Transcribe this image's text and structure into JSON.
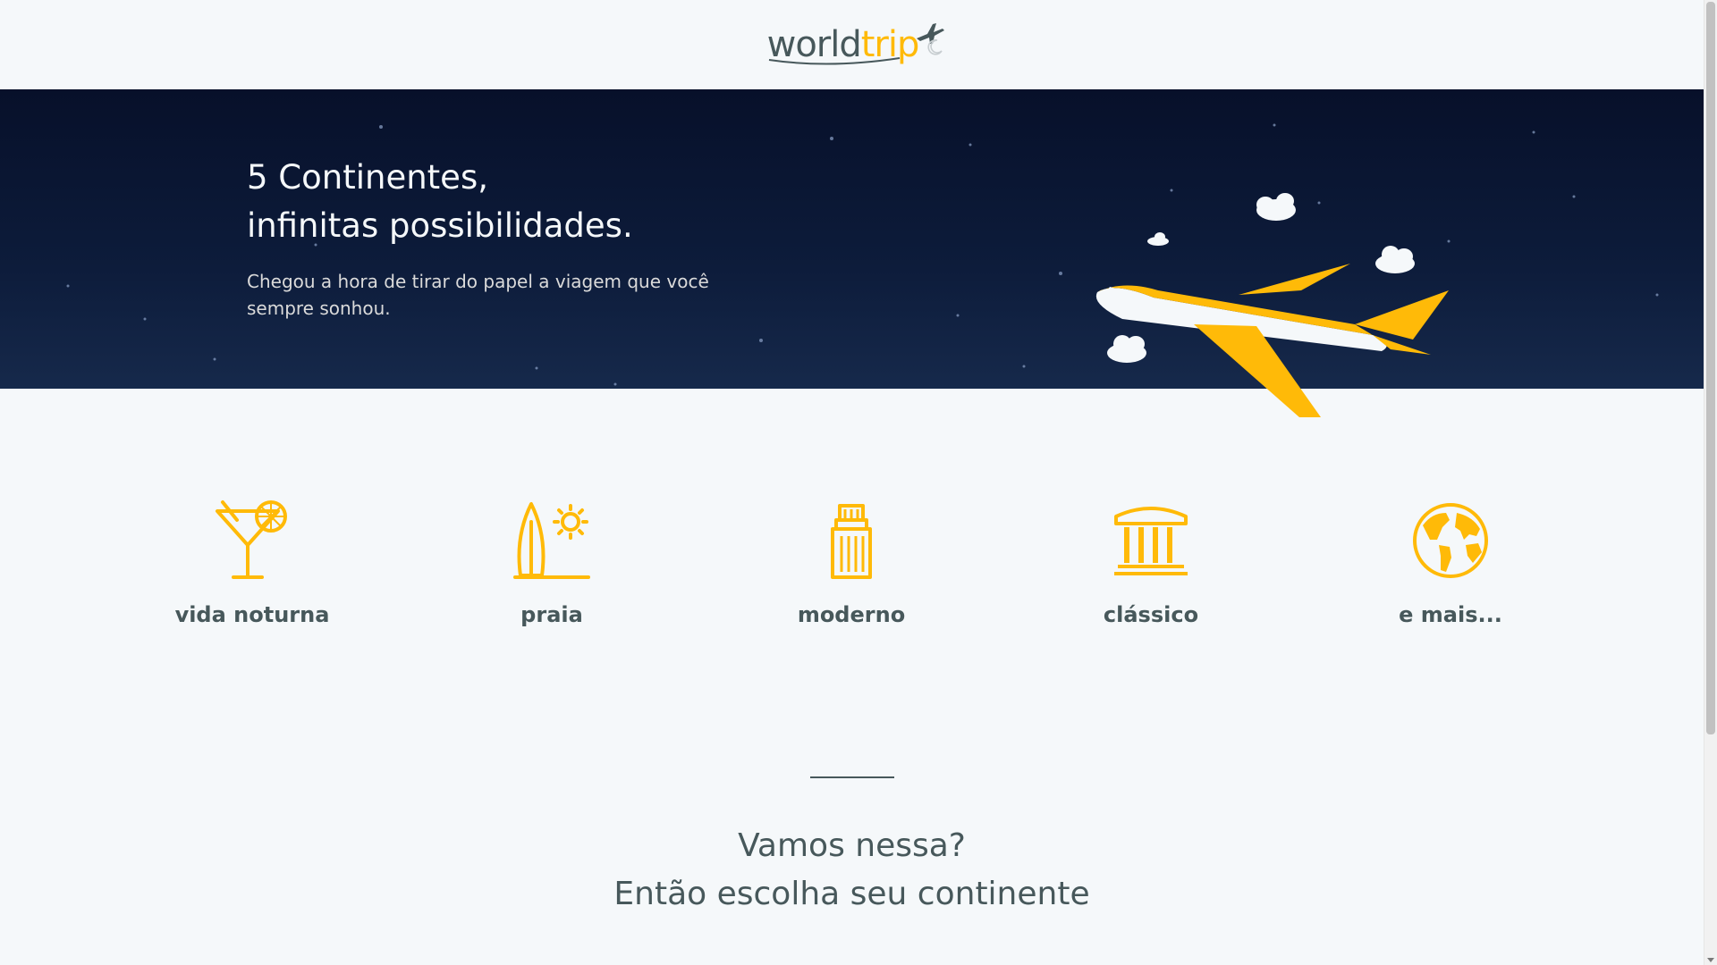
{
  "header": {
    "logo_part1": "world",
    "logo_part2": "trip",
    "theme_toggle_icon": "moon-icon"
  },
  "banner": {
    "title_line1": "5 Continentes,",
    "title_line2": "infinitas possibilidades.",
    "subtitle": "Chegou a hora de tirar do papel a viagem que você sempre sonhou.",
    "illustration": "airplane-with-clouds"
  },
  "travel_types": [
    {
      "label": "vida noturna",
      "icon": "cocktail-icon"
    },
    {
      "label": "praia",
      "icon": "surfboard-sun-icon"
    },
    {
      "label": "moderno",
      "icon": "building-icon"
    },
    {
      "label": "clássico",
      "icon": "museum-icon"
    },
    {
      "label": "e mais...",
      "icon": "globe-icon"
    }
  ],
  "cta": {
    "line1": "Vamos nessa?",
    "line2": "Então escolha seu continente"
  },
  "colors": {
    "accent": "#FFBA08",
    "text_dark": "#47585B",
    "background": "#F5F8FA",
    "banner_dark": "#0D1C3B"
  }
}
